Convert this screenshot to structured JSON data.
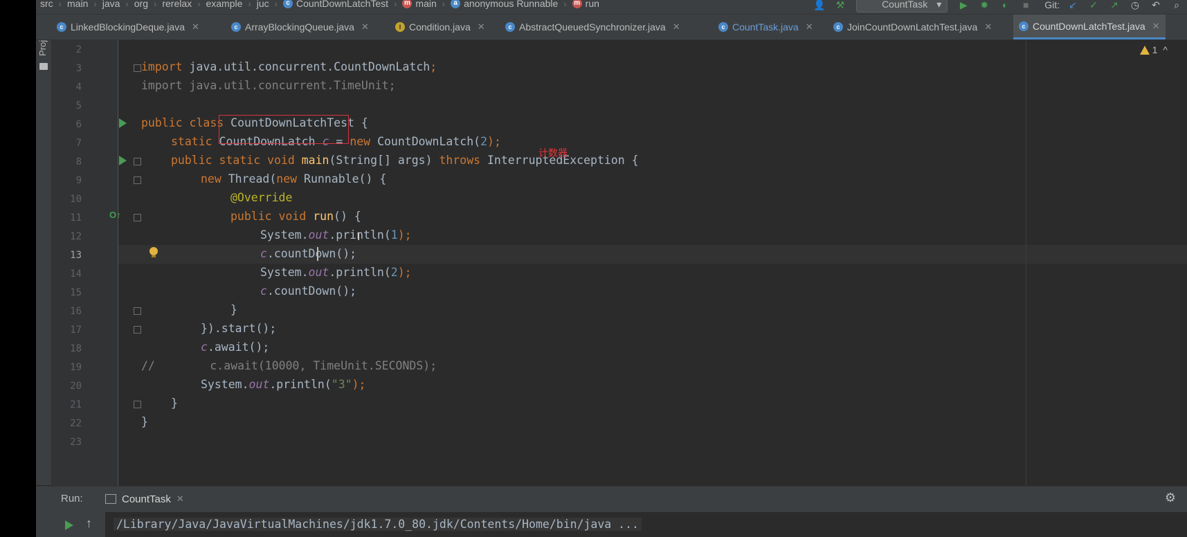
{
  "breadcrumb": [
    "src",
    "main",
    "java",
    "org",
    "rerelax",
    "example",
    "juc",
    "CountDownLatchTest",
    "main",
    "anonymous Runnable",
    "run"
  ],
  "toolbar": {
    "run_config": "CountTask",
    "git_label": "Git:"
  },
  "tabs": [
    "LinkedBlockingDeque.java",
    "ArrayBlockingQueue.java",
    "Condition.java",
    "AbstractQueuedSynchronizer.java",
    "CountTask.java",
    "JoinCountDownLatchTest.java",
    "CountDownLatchTest.java"
  ],
  "side_panel": {
    "project_label": "Project"
  },
  "editor": {
    "warning_count": "1",
    "warning_chevron": "^",
    "line_numbers": [
      "2",
      "3",
      "4",
      "5",
      "6",
      "7",
      "8",
      "9",
      "10",
      "11",
      "12",
      "13",
      "14",
      "15",
      "16",
      "17",
      "18",
      "19",
      "20",
      "21",
      "22",
      "23"
    ],
    "annotation_note": "计数器",
    "code": {
      "l3": [
        "import",
        " java.util.concurrent.CountDownLatch",
        ";"
      ],
      "l4": [
        "import java.util.concurrent.TimeUnit;"
      ],
      "l6": [
        "public class ",
        "CountDownLatchTest",
        " {"
      ],
      "l7": [
        "static ",
        "CountDownLatch ",
        "c",
        " = ",
        "new ",
        "CountDownLatch(",
        "2",
        ");"
      ],
      "l8": [
        "public static void ",
        "main",
        "(String[] args) ",
        "throws ",
        "InterruptedException {"
      ],
      "l9": [
        "new ",
        "Thread(",
        "new ",
        "Runnable() {"
      ],
      "l10": [
        "@Override"
      ],
      "l11": [
        "public void ",
        "run",
        "() {"
      ],
      "l12": [
        "System.",
        "out",
        ".println(",
        "1",
        ");"
      ],
      "l13": [
        "c",
        ".countDown();"
      ],
      "l14": [
        "System.",
        "out",
        ".println(",
        "2",
        ");"
      ],
      "l15": [
        "c",
        ".countDown();"
      ],
      "l16": [
        "}"
      ],
      "l17": [
        "}).start();"
      ],
      "l18": [
        "c",
        ".await();"
      ],
      "l19": [
        "//        c.await(10000, TimeUnit.SECONDS);"
      ],
      "l20": [
        "System.",
        "out",
        ".println(",
        "\"3\"",
        ");"
      ],
      "l21": [
        "}"
      ],
      "l22": [
        "}"
      ]
    }
  },
  "run_panel": {
    "label": "Run:",
    "tab": "CountTask",
    "console_line": "/Library/Java/JavaVirtualMachines/jdk1.7.0_80.jdk/Contents/Home/bin/java ..."
  }
}
